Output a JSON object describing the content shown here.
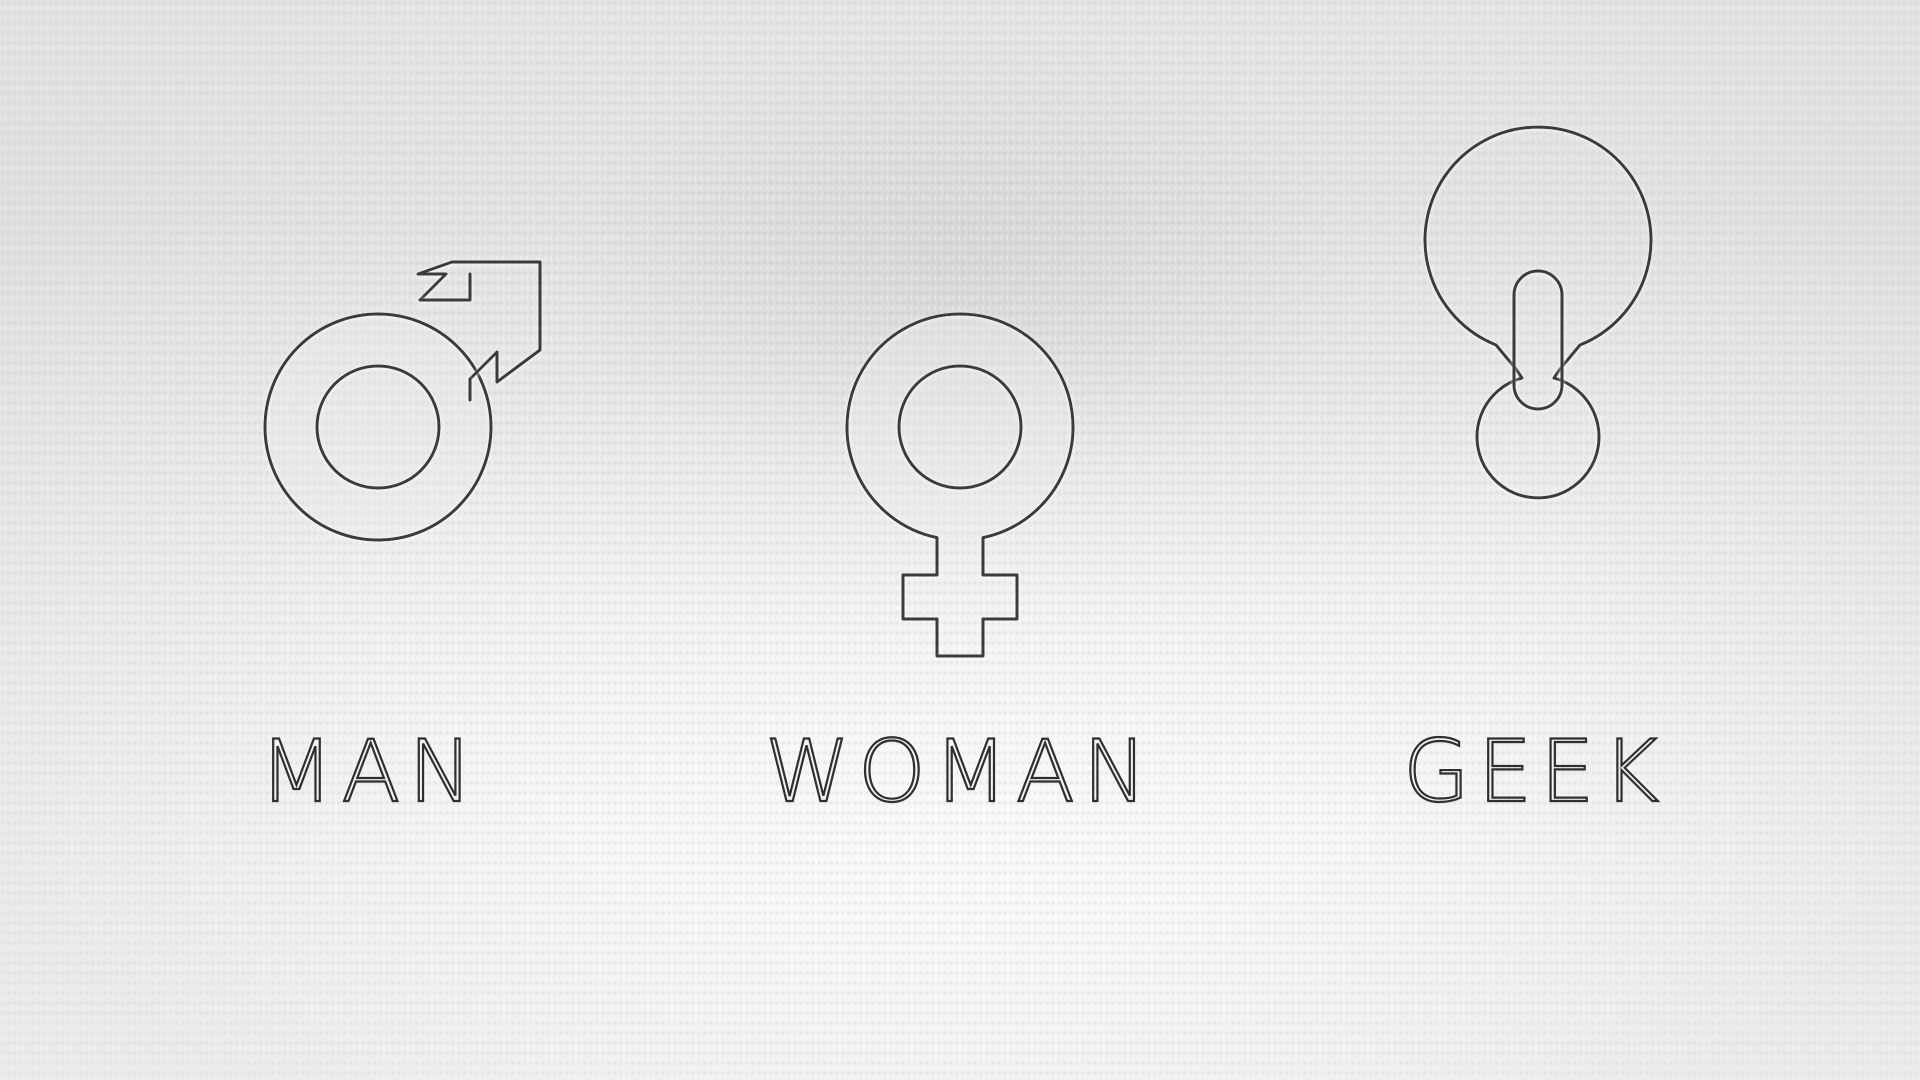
{
  "symbols": [
    {
      "icon": "male-symbol-icon",
      "label": "MAN"
    },
    {
      "icon": "female-symbol-icon",
      "label": "WOMAN"
    },
    {
      "icon": "power-symbol-icon",
      "label": "GEEK"
    }
  ],
  "colors": {
    "background": "#f1f1f1",
    "outline": "#3a3a3a"
  }
}
